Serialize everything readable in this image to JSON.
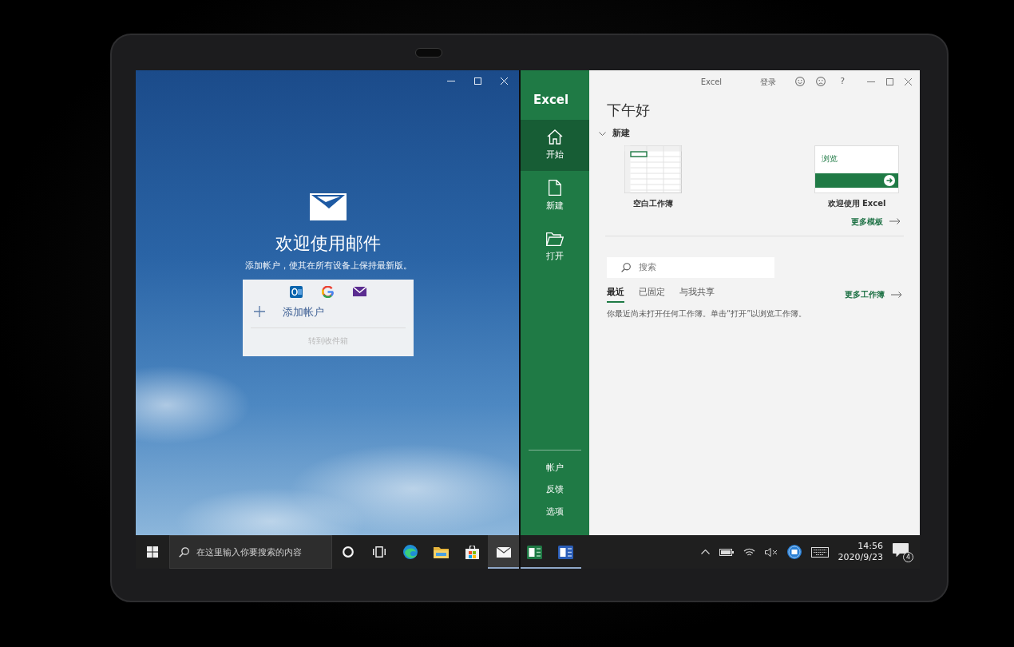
{
  "mail_window": {
    "welcome_title": "欢迎使用邮件",
    "welcome_subtitle": "添加帐户，使其在所有设备上保持最新版。",
    "add_account": {
      "label": "添加帐户"
    },
    "go_to_inbox": {
      "label": "转到收件箱",
      "disabled": true
    }
  },
  "excel_window": {
    "app_name": "Excel",
    "title_bar": {
      "title": "Excel",
      "sign_in": "登录",
      "help": "?"
    },
    "nav": [
      {
        "kind": "home",
        "label": "开始",
        "selected": true
      },
      {
        "kind": "new",
        "label": "新建",
        "selected": false
      },
      {
        "kind": "open",
        "label": "打开",
        "selected": false
      }
    ],
    "nav_bottom": [
      {
        "label": "帐户"
      },
      {
        "label": "反馈"
      },
      {
        "label": "选项"
      }
    ],
    "greeting": "下午好",
    "new_section": {
      "label": "新建",
      "expanded": true
    },
    "templates": [
      {
        "kind": "blank",
        "label": "空白工作簿"
      },
      {
        "kind": "tour",
        "label": "欢迎使用 Excel",
        "preview_caption": "浏览"
      }
    ],
    "more_templates": "更多模板",
    "search": {
      "placeholder": "搜索"
    },
    "tabs": [
      {
        "label": "最近",
        "selected": true
      },
      {
        "label": "已固定",
        "selected": false
      },
      {
        "label": "与我共享",
        "selected": false
      }
    ],
    "more_workbooks": "更多工作簿",
    "empty_message": "你最近尚未打开任何工作簿。单击“打开”以浏览工作簿。"
  },
  "taskbar": {
    "search": {
      "placeholder": "在这里输入你要搜索的内容"
    },
    "apps": [
      {
        "kind": "circle",
        "running": false,
        "selected": false
      },
      {
        "kind": "taskview",
        "running": false,
        "selected": false
      },
      {
        "kind": "browser",
        "running": false,
        "selected": false
      },
      {
        "kind": "folder",
        "running": false,
        "selected": false
      },
      {
        "kind": "store",
        "running": false,
        "selected": false
      },
      {
        "kind": "mail",
        "running": true,
        "selected": true
      },
      {
        "kind": "spreadsheet",
        "running": true,
        "selected": false
      },
      {
        "kind": "document",
        "running": true,
        "selected": false
      }
    ],
    "time": "14:56",
    "date": "2020/9/23",
    "notification_count": "4"
  }
}
